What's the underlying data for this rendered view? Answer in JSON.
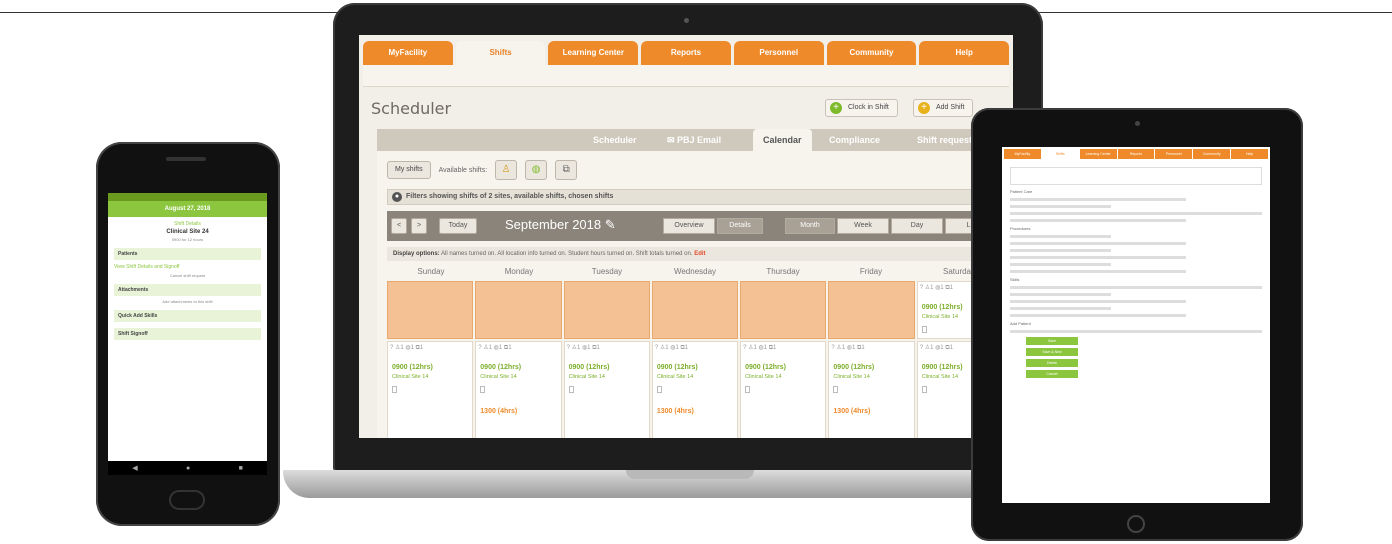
{
  "laptop": {
    "nav_tabs": [
      {
        "label": "MyFacility",
        "active": false
      },
      {
        "label": "Shifts",
        "active": true
      },
      {
        "label": "Learning Center",
        "active": false
      },
      {
        "label": "Reports",
        "active": false
      },
      {
        "label": "Personnel",
        "active": false
      },
      {
        "label": "Community",
        "active": false
      },
      {
        "label": "Help",
        "active": false
      }
    ],
    "page_title": "Scheduler",
    "header_buttons": {
      "clock_in": "Clock in Shift",
      "add_shift": "Add Shift"
    },
    "subtabs": [
      {
        "label": "Scheduler",
        "active": false
      },
      {
        "label": "PBJ Email",
        "active": false
      },
      {
        "label": "Calendar",
        "active": true
      },
      {
        "label": "Compliance",
        "active": false
      },
      {
        "label": "Shift requests",
        "active": false
      }
    ],
    "filter": {
      "my_shifts": "My shifts",
      "available_label": "Available shifts:"
    },
    "filter_bar": "Filters showing shifts of 2 sites, available shifts, chosen shifts",
    "calendar": {
      "prev": "<",
      "next": ">",
      "today": "Today",
      "month_title": "September 2018",
      "overview": "Overview",
      "details": "Details",
      "views": [
        "Month",
        "Week",
        "Day",
        "List"
      ],
      "display_options": "Display options:",
      "display_text": "All names turned on. All location info turned on. Student hours turned on. Shift totals turned on.",
      "display_edit": "Edit",
      "days": [
        "Sunday",
        "Monday",
        "Tuesday",
        "Wednesday",
        "Thursday",
        "Friday",
        "Saturday"
      ],
      "cells": [
        {
          "time": "0900 (12hrs)",
          "site": "Clinical Site 14",
          "second": ""
        },
        {
          "time": "0900 (12hrs)",
          "site": "Clinical Site 14",
          "second": "1300 (4hrs)"
        },
        {
          "time": "0900 (12hrs)",
          "site": "Clinical Site 14",
          "second": ""
        },
        {
          "time": "0900 (12hrs)",
          "site": "Clinical Site 14",
          "second": "1300 (4hrs)"
        },
        {
          "time": "0900 (12hrs)",
          "site": "Clinical Site 14",
          "second": ""
        },
        {
          "time": "0900 (12hrs)",
          "site": "Clinical Site 14",
          "second": "1300 (4hrs)"
        },
        {
          "time": "0900 (12hrs)",
          "site": "Clinical Site 14",
          "second": ""
        }
      ],
      "saturday_top": {
        "time": "0900 (12hrs)",
        "site": "Clinical Site 14"
      }
    }
  },
  "phone": {
    "header": "August 27, 2018",
    "shift_label": "Shift Details",
    "site": "Clinical Site 24",
    "sub": "0900 for 12 hours",
    "sections": [
      "Patients",
      "Attachments",
      "Quick Add Skills",
      "Shift Signoff"
    ],
    "lines": [
      "View Shift Details and Signoff",
      "Cancel shift request",
      "Add attachments to this shift"
    ],
    "nav": [
      "◀",
      "●",
      "■"
    ]
  },
  "tablet": {
    "tabs": [
      "MyFacility",
      "Shifts",
      "Learning Center",
      "Reports",
      "Personnel",
      "Community",
      "Help"
    ],
    "texts": [
      "Patient Care",
      "Procedures",
      "Skills",
      "Add Patient"
    ],
    "buttons": [
      "Save",
      "Save & New",
      "Delete",
      "Cancel"
    ]
  },
  "colors": {
    "brand_orange": "#ee8a2a",
    "brand_green": "#8cc63f"
  }
}
